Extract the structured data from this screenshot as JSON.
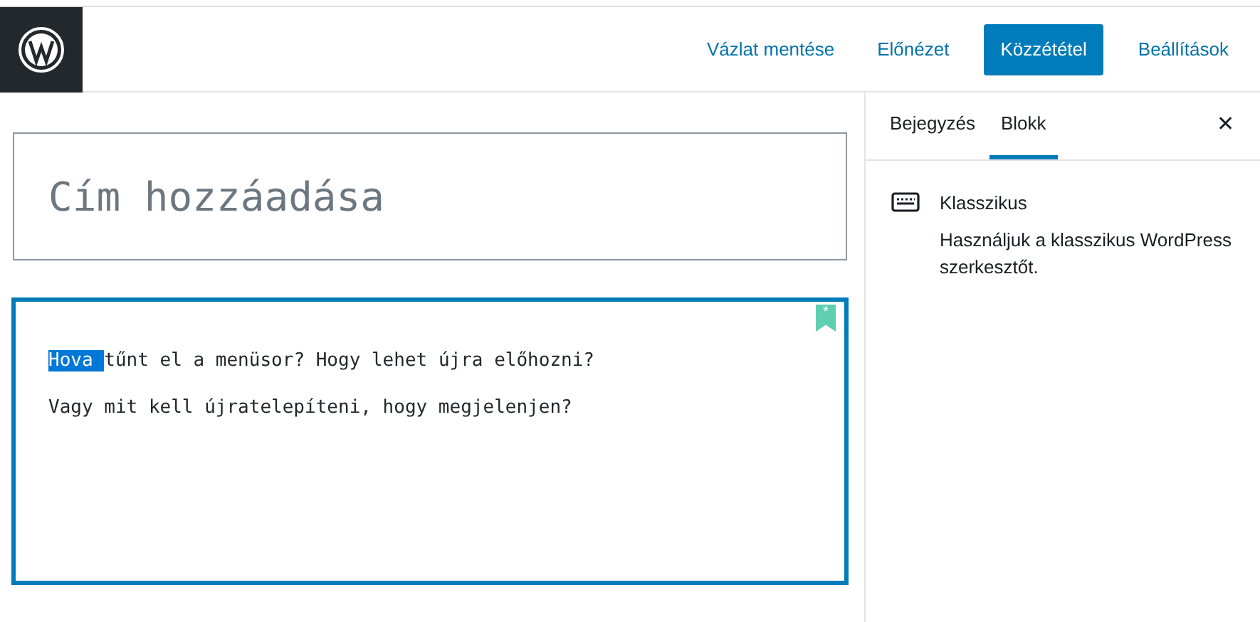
{
  "header": {
    "actions": [
      {
        "label": "Vázlat mentése",
        "kind": "link"
      },
      {
        "label": "Előnézet",
        "kind": "link"
      },
      {
        "label": "Közzététel",
        "kind": "primary"
      },
      {
        "label": "Beállítások",
        "kind": "link"
      }
    ]
  },
  "editor": {
    "title": {
      "placeholder": "Cím hozzáadása"
    },
    "block": {
      "selected": true,
      "bookmark": "*",
      "paragraphs": [
        {
          "highlight": "Hova ",
          "text": "tűnt el a menüsor? Hogy lehet újra előhozni?"
        },
        {
          "text": "Vagy mit kell újratelepíteni, hogy megjelenjen?"
        }
      ]
    }
  },
  "sidebar": {
    "tabs": [
      {
        "label": "Bejegyzés",
        "selected": false
      },
      {
        "label": "Blokk",
        "selected": true
      }
    ],
    "close": "✕",
    "block_card": {
      "title": "Klasszikus",
      "description": "Használjuk a klasszikus WordPress szerkesztőt."
    }
  }
}
